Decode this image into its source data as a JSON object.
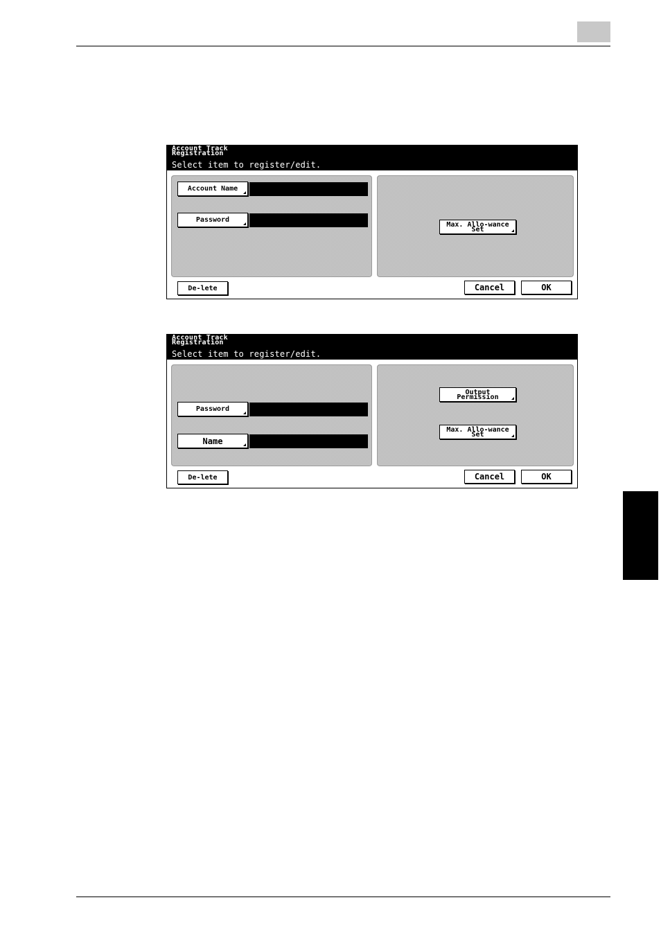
{
  "screens": [
    {
      "title": "Account Track Registration",
      "instruction": "Select item to register/edit.",
      "left_buttons": [
        "Account Name",
        "Password"
      ],
      "right_buttons": [
        "Max. Allo-wance Set"
      ],
      "delete_label": "De-lete",
      "cancel_label": "Cancel",
      "ok_label": "OK"
    },
    {
      "title": "Account Track Registration",
      "instruction": "Select item to register/edit.",
      "left_buttons": [
        "Password",
        "Name"
      ],
      "right_buttons": [
        "Output Permission",
        "Max. Allo-wance Set"
      ],
      "delete_label": "De-lete",
      "cancel_label": "Cancel",
      "ok_label": "OK"
    }
  ]
}
